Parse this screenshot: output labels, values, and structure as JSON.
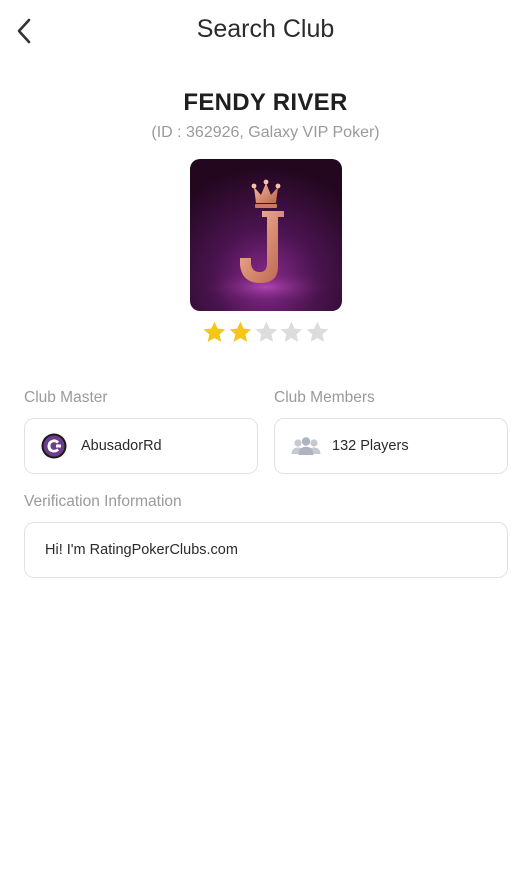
{
  "header": {
    "title": "Search Club",
    "back_icon": "chevron-left-icon"
  },
  "club": {
    "name": "FENDY RIVER",
    "subtitle": "(ID : 362926, Galaxy VIP Poker)",
    "logo_icon": "crowned-letter-j-logo",
    "logo_letter": "J",
    "rating": {
      "filled": 2,
      "total": 5,
      "filled_color": "#f5c518",
      "empty_color": "#dcdcdc"
    }
  },
  "master": {
    "label": "Club Master",
    "name": "AbusadorRd",
    "avatar_icon": "avatar-icon"
  },
  "members": {
    "label": "Club Members",
    "count_text": "132 Players",
    "icon": "people-icon"
  },
  "verification": {
    "label": "Verification Information",
    "text": "Hi! I'm RatingPokerClubs.com"
  }
}
